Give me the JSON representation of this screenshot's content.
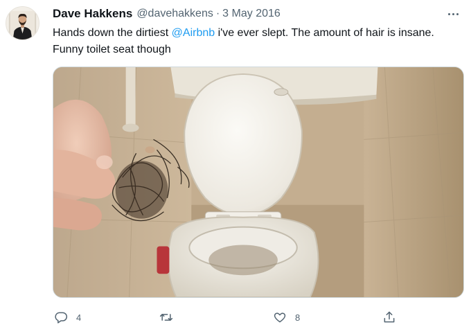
{
  "tweet": {
    "author": {
      "display_name": "Dave Hakkens",
      "handle": "@davehakkens",
      "avatar_icon": "profile-photo"
    },
    "separator": "·",
    "date": "3 May 2016",
    "text": {
      "before_mention": "Hands down the dirtiest ",
      "mention": "@Airbnb",
      "after_mention": " i've ever slept. The amount of hair is insane. Funny toilet seat though"
    },
    "media": {
      "type": "photo",
      "subject": "toilet-with-hair"
    },
    "actions": {
      "reply": {
        "icon": "reply-icon",
        "count": "4"
      },
      "retweet": {
        "icon": "retweet-icon",
        "count": ""
      },
      "like": {
        "icon": "heart-icon",
        "count": "8"
      },
      "share": {
        "icon": "share-icon",
        "count": ""
      }
    },
    "more_icon": "more-icon"
  },
  "colors": {
    "text_primary": "#0f1419",
    "text_secondary": "#536471",
    "link": "#1d9bf0",
    "border": "#cfd9de"
  }
}
